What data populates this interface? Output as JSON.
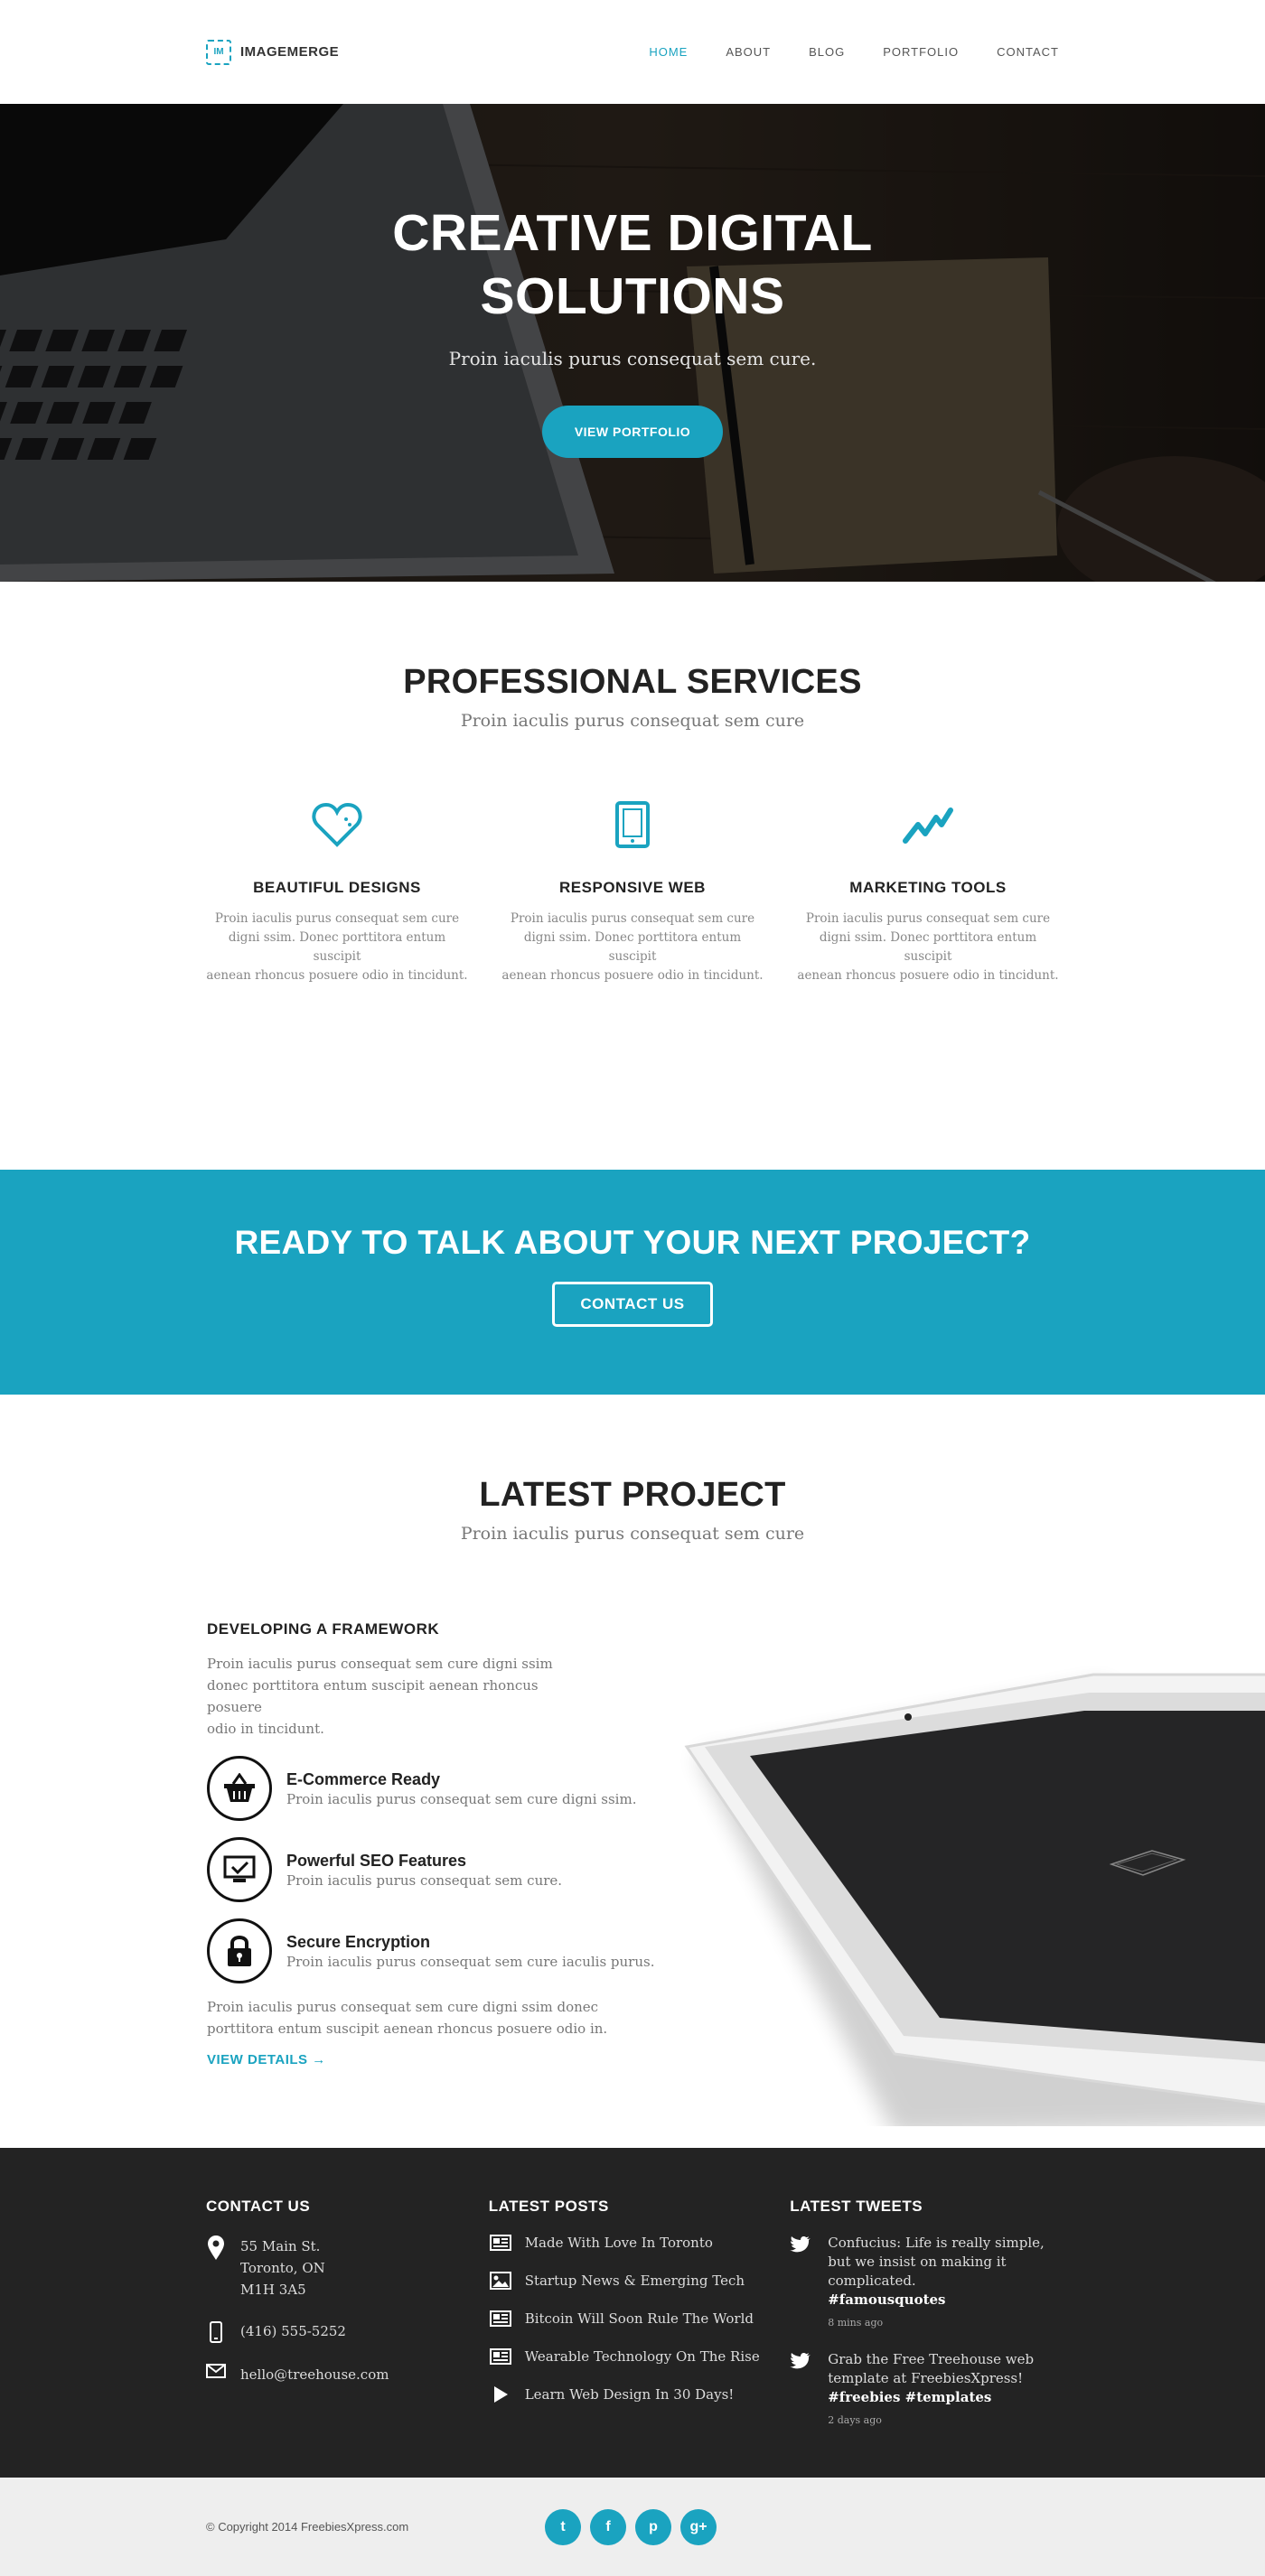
{
  "header": {
    "logo_mark": "IM",
    "logo_text": "IMAGEMERGE",
    "nav": [
      "HOME",
      "ABOUT",
      "BLOG",
      "PORTFOLIO",
      "CONTACT"
    ],
    "active_nav": "HOME"
  },
  "hero": {
    "title_line1": "CREATIVE DIGITAL",
    "title_line2": "SOLUTIONS",
    "subtitle": "Proin iaculis purus consequat sem cure.",
    "button": "VIEW PORTFOLIO"
  },
  "services": {
    "title": "PROFESSIONAL SERVICES",
    "subtitle": "Proin iaculis purus consequat sem cure",
    "items": [
      {
        "icon": "heart-icon",
        "title": "BEAUTIFUL DESIGNS",
        "line1": "Proin iaculis purus consequat sem cure",
        "line2": "digni ssim. Donec porttitora entum suscipit",
        "line3": "aenean rhoncus posuere odio in tincidunt."
      },
      {
        "icon": "tablet-icon",
        "title": "RESPONSIVE WEB",
        "line1": "Proin iaculis purus consequat sem cure",
        "line2": "digni ssim. Donec porttitora entum suscipit",
        "line3": "aenean rhoncus posuere odio in tincidunt."
      },
      {
        "icon": "trend-icon",
        "title": "MARKETING TOOLS",
        "line1": "Proin iaculis purus consequat sem cure",
        "line2": "digni ssim. Donec porttitora entum suscipit",
        "line3": "aenean rhoncus posuere odio in tincidunt."
      }
    ]
  },
  "cta": {
    "title": "READY TO TALK ABOUT YOUR NEXT PROJECT?",
    "button": "CONTACT US"
  },
  "project": {
    "title": "LATEST PROJECT",
    "subtitle": "Proin iaculis purus consequat sem cure",
    "heading": "DEVELOPING A FRAMEWORK",
    "intro_line1": "Proin iaculis purus consequat sem cure  digni ssim",
    "intro_line2": "donec porttitora entum suscipit  aenean rhoncus posuere",
    "intro_line3": "odio in tincidunt.",
    "features": [
      {
        "icon": "basket-icon",
        "title": "E-Commerce Ready",
        "text": "Proin iaculis purus consequat sem cure  digni ssim."
      },
      {
        "icon": "monitor-check-icon",
        "title": "Powerful SEO Features",
        "text": "Proin iaculis purus consequat sem cure."
      },
      {
        "icon": "lock-icon",
        "title": "Secure Encryption",
        "text": "Proin iaculis purus consequat sem cure iaculis purus."
      }
    ],
    "outro_line1": "Proin iaculis purus consequat sem cure  digni ssim donec",
    "outro_line2": "porttitora entum suscipit  aenean rhoncus posuere odio in.",
    "link": "VIEW DETAILS",
    "link_arrow": "→"
  },
  "footer": {
    "contact": {
      "title": "CONTACT US",
      "address_line1": "55 Main St.",
      "address_line2": "Toronto, ON",
      "address_line3": "M1H 3A5",
      "phone": "(416) 555-5252",
      "email": "hello@treehouse.com"
    },
    "posts": {
      "title": "LATEST POSTS",
      "items": [
        {
          "icon": "news-icon",
          "text": "Made With Love In Toronto"
        },
        {
          "icon": "image-icon",
          "text": "Startup News & Emerging Tech"
        },
        {
          "icon": "news-icon",
          "text": "Bitcoin Will Soon Rule The World"
        },
        {
          "icon": "news-icon",
          "text": "Wearable Technology On The Rise"
        },
        {
          "icon": "play-icon",
          "text": "Learn Web Design In 30 Days!"
        }
      ]
    },
    "tweets": {
      "title": "LATEST TWEETS",
      "items": [
        {
          "line1": "Confucius: Life is really simple,",
          "line2": "but we insist on making it",
          "line3": "complicated.",
          "tags": "#famousquotes",
          "time": "8 mins ago"
        },
        {
          "line1": "Grab the Free Treehouse web",
          "line2": "template at FreebiesXpress!",
          "line3": "",
          "tags": "#freebies #templates",
          "time": "2 days ago"
        }
      ]
    }
  },
  "bottom": {
    "copyright": "© Copyright 2014 FreebiesXpress.com",
    "social": [
      {
        "icon": "twitter-icon",
        "glyph": "t"
      },
      {
        "icon": "facebook-icon",
        "glyph": "f"
      },
      {
        "icon": "pinterest-icon",
        "glyph": "p"
      },
      {
        "icon": "googleplus-icon",
        "glyph": "g+"
      }
    ]
  },
  "colors": {
    "accent": "#1aa3c0",
    "footer_bg": "#232323",
    "bottom_bg": "#eeeeee"
  }
}
